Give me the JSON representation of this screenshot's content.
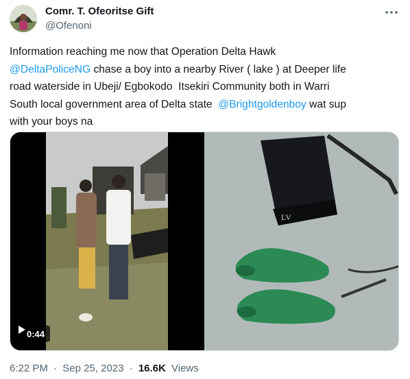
{
  "author": {
    "display_name": "Comr. T. Ofeoritse Gift",
    "handle": "@Ofenoni"
  },
  "more_icon": "more-horizontal-icon",
  "tweet_text": {
    "lines": [
      [
        {
          "t": "Information reaching me now that Operation Delta Hawk",
          "m": false
        }
      ],
      [
        {
          "t": "@DeltaPoliceNG",
          "m": true
        },
        {
          "t": " chase a boy into a nearby River ( lake ) at Deeper life",
          "m": false
        }
      ],
      [
        {
          "t": "road waterside in Ubeji/ Egbokodo  Itsekiri Community both in Warri",
          "m": false
        }
      ],
      [
        {
          "t": "South local government area of Delta state  ",
          "m": false
        },
        {
          "t": "@Brightgoldenboy",
          "m": true
        },
        {
          "t": " wat sup",
          "m": false
        }
      ],
      [
        {
          "t": "with your boys na",
          "m": false
        }
      ]
    ]
  },
  "media": {
    "video_duration": "0:44",
    "play_icon": "play-icon"
  },
  "meta": {
    "time": "6:22 PM",
    "separator": "·",
    "date": "Sep 25, 2023",
    "views_count": "16.6K",
    "views_label": "Views"
  },
  "colors": {
    "link": "#1d9bf0",
    "secondary_text": "#536471",
    "primary_text": "#0f1419",
    "border": "#cfd9de"
  }
}
